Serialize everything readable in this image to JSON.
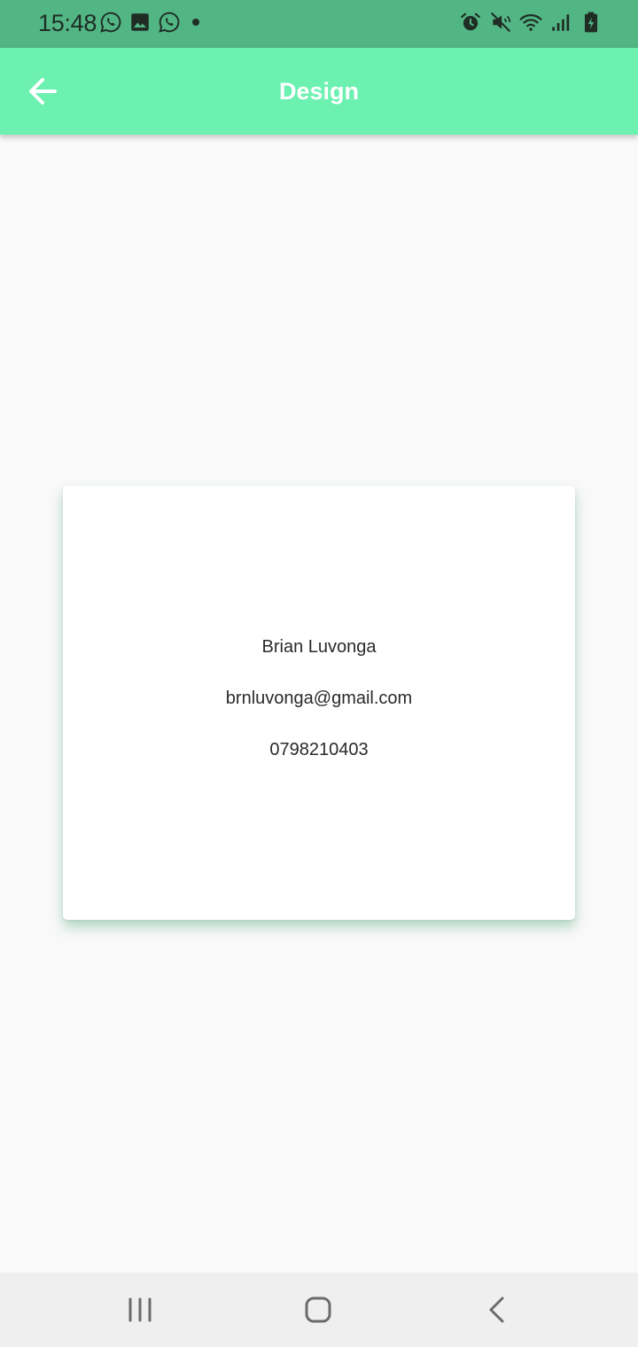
{
  "status_bar": {
    "time": "15:48",
    "left_icons": [
      "whatsapp-icon",
      "gallery-icon",
      "whatsapp-icon",
      "dot-icon"
    ],
    "right_icons": [
      "alarm-icon",
      "mute-icon",
      "wifi-icon",
      "signal-icon",
      "battery-icon"
    ],
    "background_color": "#52b584"
  },
  "app_bar": {
    "title": "Design",
    "back_icon": "arrow-back-icon",
    "background_color": "#6cf1b1"
  },
  "card": {
    "name": "Brian Luvonga",
    "email": "brnluvonga@gmail.com",
    "phone": "0798210403"
  },
  "nav_bar": {
    "buttons": [
      "recent-apps-icon",
      "home-icon",
      "back-icon"
    ]
  }
}
